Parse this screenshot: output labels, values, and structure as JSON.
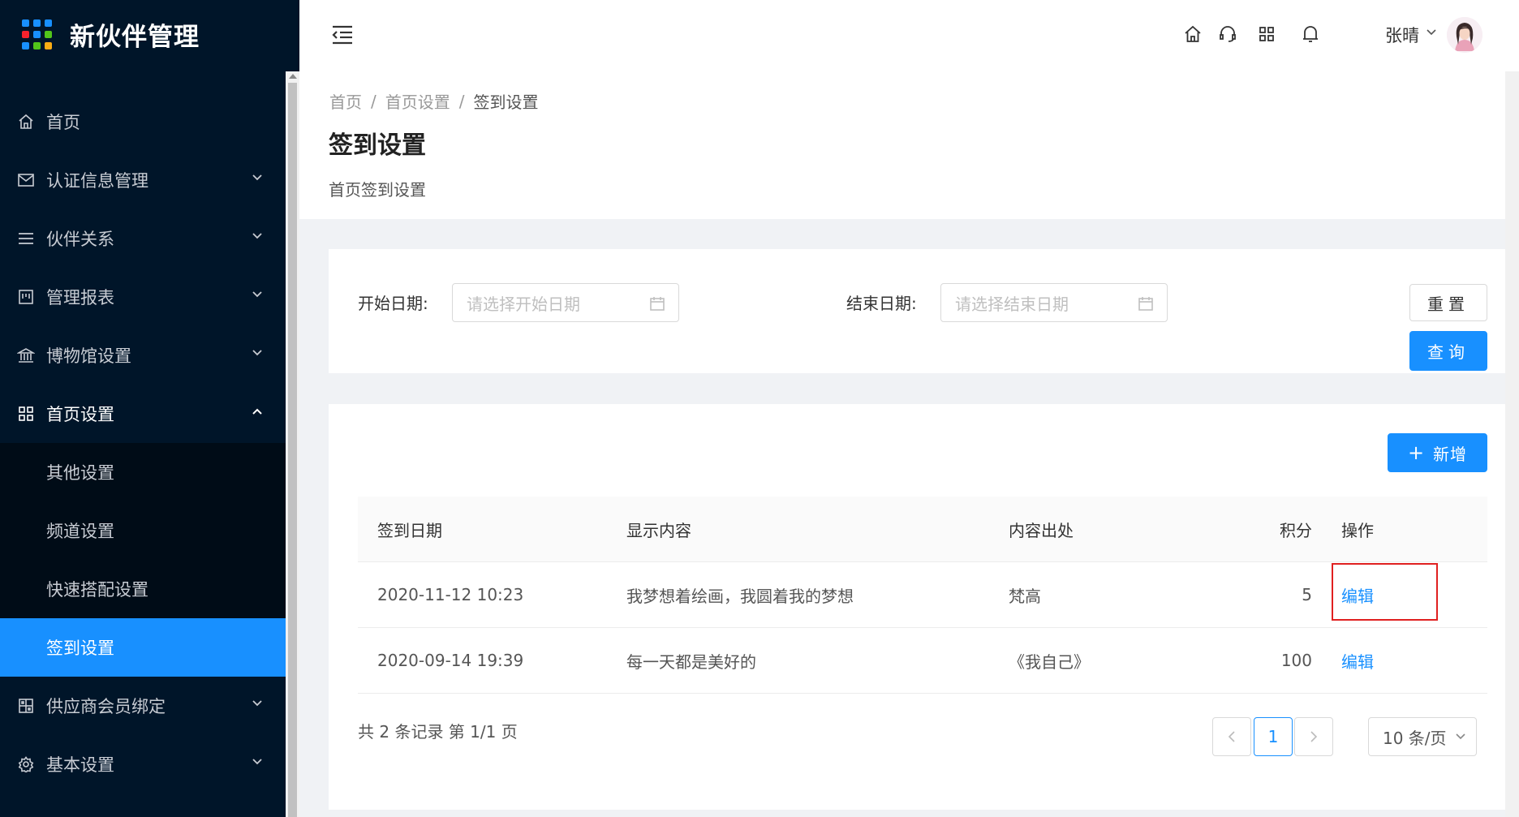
{
  "app": {
    "title": "新伙伴管理"
  },
  "colors": {
    "sidebar_bg": "#001529",
    "accent": "#1890ff",
    "highlight_border": "#e02020"
  },
  "sidebar": {
    "items": [
      {
        "label": "首页",
        "icon": "home-icon"
      },
      {
        "label": "认证信息管理",
        "icon": "mail-icon"
      },
      {
        "label": "伙伴关系",
        "icon": "menu-lines-icon"
      },
      {
        "label": "管理报表",
        "icon": "report-icon"
      },
      {
        "label": "博物馆设置",
        "icon": "bank-icon"
      },
      {
        "label": "首页设置",
        "icon": "appstore-icon"
      },
      {
        "label": "供应商会员绑定",
        "icon": "grid-icon"
      },
      {
        "label": "基本设置",
        "icon": "gear-icon"
      }
    ],
    "subitems": [
      {
        "label": "其他设置"
      },
      {
        "label": "频道设置"
      },
      {
        "label": "快速搭配设置"
      },
      {
        "label": "签到设置"
      }
    ]
  },
  "header": {
    "user_name": "张晴",
    "icons": [
      "home-icon",
      "headset-icon",
      "apps-icon",
      "bell-icon"
    ]
  },
  "breadcrumb": {
    "items": [
      "首页",
      "首页设置",
      "签到设置"
    ],
    "separator": "/"
  },
  "page": {
    "title": "签到设置",
    "description": "首页签到设置"
  },
  "search": {
    "start_label": "开始日期:",
    "start_placeholder": "请选择开始日期",
    "end_label": "结束日期:",
    "end_placeholder": "请选择结束日期",
    "reset_label": "重置",
    "query_label": "查询"
  },
  "table": {
    "add_label": "新增",
    "columns": [
      "签到日期",
      "显示内容",
      "内容出处",
      "积分",
      "操作"
    ],
    "rows": [
      {
        "date": "2020-11-12 10:23",
        "content": "我梦想着绘画，我圆着我的梦想",
        "source": "梵高",
        "points": "5",
        "action": "编辑"
      },
      {
        "date": "2020-09-14 19:39",
        "content": "每一天都是美好的",
        "source": "《我自己》",
        "points": "100",
        "action": "编辑"
      }
    ]
  },
  "pagination": {
    "total_text": "共 2 条记录 第 1/1 页",
    "current_page": "1",
    "page_size": "10 条/页"
  }
}
